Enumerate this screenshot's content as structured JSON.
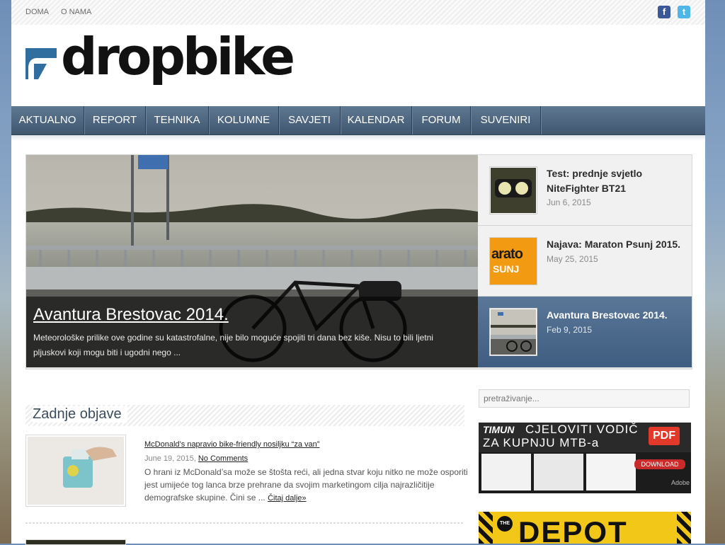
{
  "topbar": {
    "links": [
      "DOMA",
      "O NAMA"
    ],
    "social": [
      "facebook-icon",
      "twitter-icon"
    ]
  },
  "logo": {
    "text": "dropbike"
  },
  "nav": {
    "items": [
      "AKTUALNO",
      "REPORT",
      "TEHNIKA",
      "KOLUMNE",
      "SAVJETI",
      "KALENDAR",
      "FORUM",
      "SUVENIRI"
    ]
  },
  "slider": {
    "main": {
      "title": "Avantura Brestovac 2014.",
      "excerpt": "Meteorološke prilike ove godine su katastrofalne, nije bilo moguće spojiti tri dana bez kiše. Nisu to bili ljetni pljuskovi koji mogu biti i ugodni nego ..."
    },
    "items": [
      {
        "title": "Test: prednje svjetlo NiteFighter BT21",
        "date": "Jun 6, 2015"
      },
      {
        "title": "Najava: Maraton Psunj 2015.",
        "date": "May 25, 2015",
        "thumb_text_1": "arato",
        "thumb_text_2": "SUNJ"
      },
      {
        "title": "Avantura Brestovac 2014.",
        "date": "Feb 9, 2015"
      }
    ]
  },
  "latest": {
    "heading": "Zadnje objave",
    "posts": [
      {
        "title": "McDonald’s napravio bike-friendly nosiljku “za van”",
        "date": "June 19, 2015,",
        "comments": "No Comments",
        "excerpt": "O hrani iz McDonald’sa može se štošta reći, ali jedna stvar koju nitko ne može osporiti jest umijeće tog lanca brze prehrane da svojim marketingom cilja najrazličitije demografske skupine. Čini se ...",
        "read_more": "Čitaj dalje»"
      }
    ]
  },
  "sidebar": {
    "search_placeholder": "pretraživanje...",
    "ad1": {
      "brand": "TIMUN",
      "line1": "CJELOVITI VODIČ",
      "line2": "ZA KUPNJU MTB-a",
      "badge": "PDF",
      "download": "DOWNLOAD",
      "adobe": "Adobe"
    },
    "ad2": {
      "small": "THE",
      "big": "DEPOT"
    }
  },
  "colors": {
    "nav_bg": "#4a627c",
    "active_slide": "#4b6a8d",
    "heading": "#3b4c5e"
  }
}
